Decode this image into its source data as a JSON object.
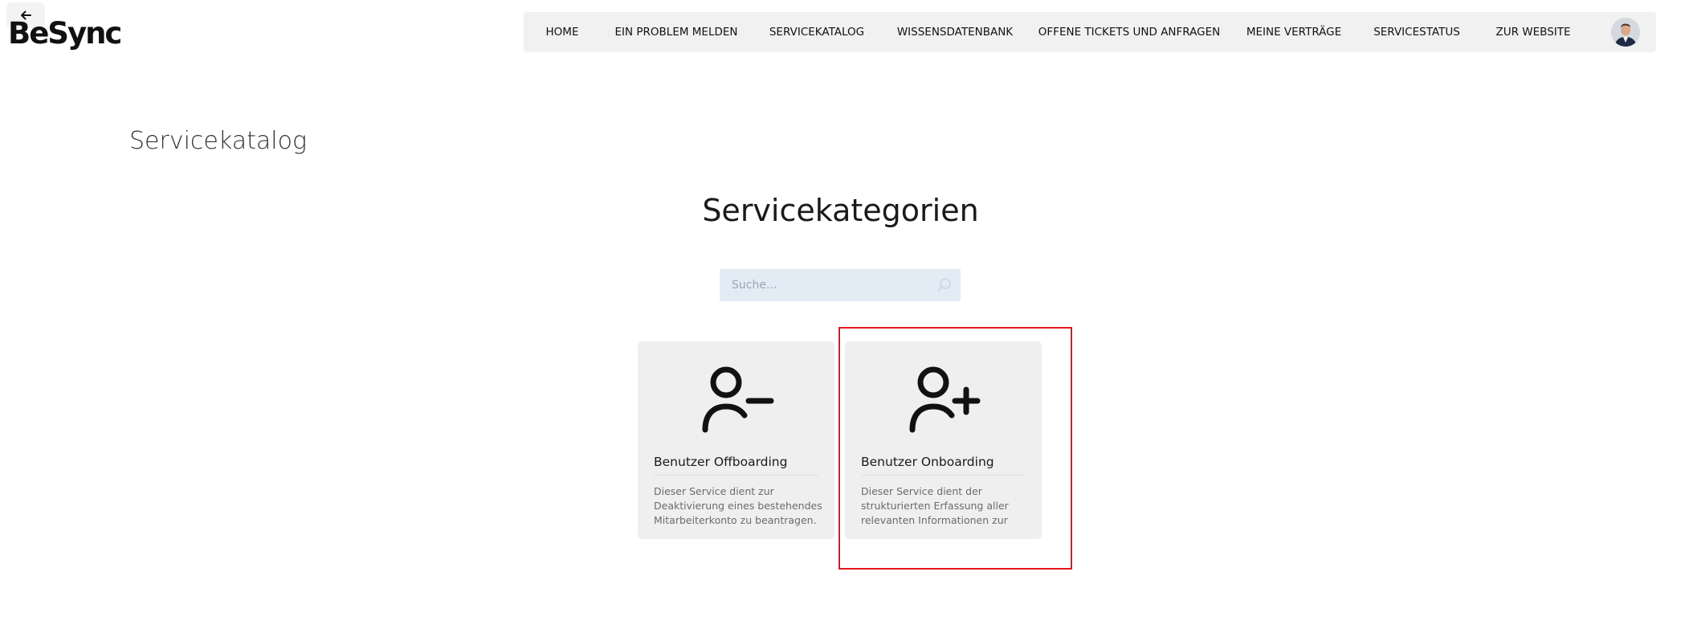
{
  "header": {
    "logo_text": "BeSync",
    "back_icon": "arrow-left-icon",
    "nav": [
      {
        "label": "HOME"
      },
      {
        "label": "EIN PROBLEM MELDEN"
      },
      {
        "label": "SERVICEKATALOG"
      },
      {
        "label": "WISSENSDATENBANK"
      },
      {
        "label": "OFFENE TICKETS UND ANFRAGEN"
      },
      {
        "label": "MEINE VERTRÄGE"
      },
      {
        "label": "SERVICESTATUS"
      },
      {
        "label": "ZUR WEBSITE"
      }
    ]
  },
  "page": {
    "title": "Servicekatalog",
    "section_title": "Servicekategorien"
  },
  "search": {
    "placeholder": "Suche...",
    "value": "",
    "icon": "search-icon"
  },
  "cards": [
    {
      "title": "Benutzer Offboarding",
      "description": "Dieser Service dient zur Deaktivierung eines bestehendes Mitarbeiterkonto zu beantragen.",
      "icon": "user-minus-icon"
    },
    {
      "title": "Benutzer Onboarding",
      "description": "Dieser Service dient der strukturierten Erfassung aller relevanten Informationen zur",
      "icon": "user-plus-icon"
    }
  ],
  "colors": {
    "nav_bg": "#f1f1f1",
    "card_bg": "#efefef",
    "search_bg": "#e3ebf5",
    "highlight": "#e3161c"
  }
}
